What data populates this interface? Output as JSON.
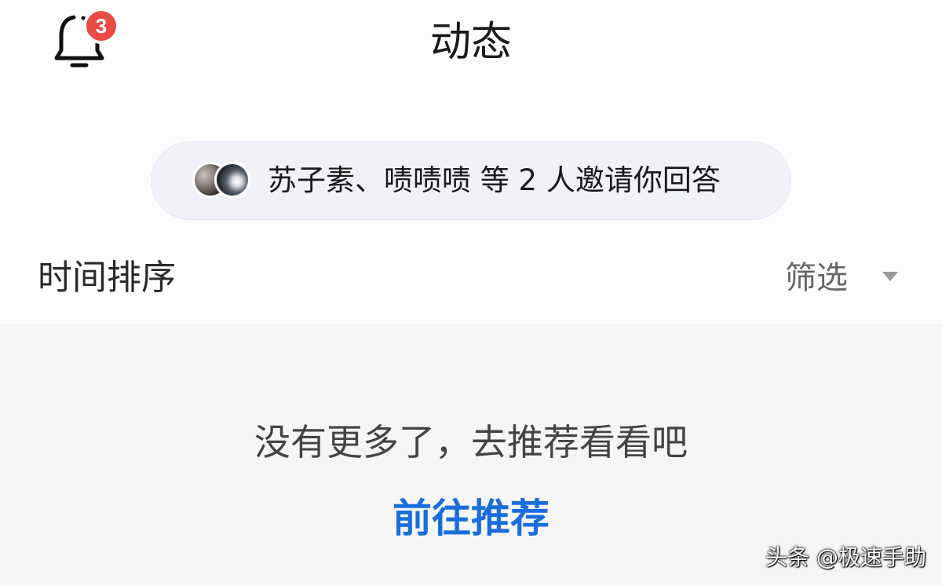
{
  "header": {
    "title": "动态",
    "notification_count": "3",
    "bell_icon": "bell-icon"
  },
  "invite": {
    "text": "苏子素、啧啧啧 等 2 人邀请你回答"
  },
  "sort_bar": {
    "label": "时间排序",
    "filter_label": "筛选",
    "filter_icon": "caret-down-icon"
  },
  "empty_state": {
    "message": "没有更多了，去推荐看看吧",
    "link": "前往推荐"
  },
  "watermark": "头条 @极速手助",
  "colors": {
    "badge": "#e94b47",
    "link": "#1a6ddb",
    "pill_bg": "#f0f2f8",
    "page_bg": "#f5f5f6"
  }
}
